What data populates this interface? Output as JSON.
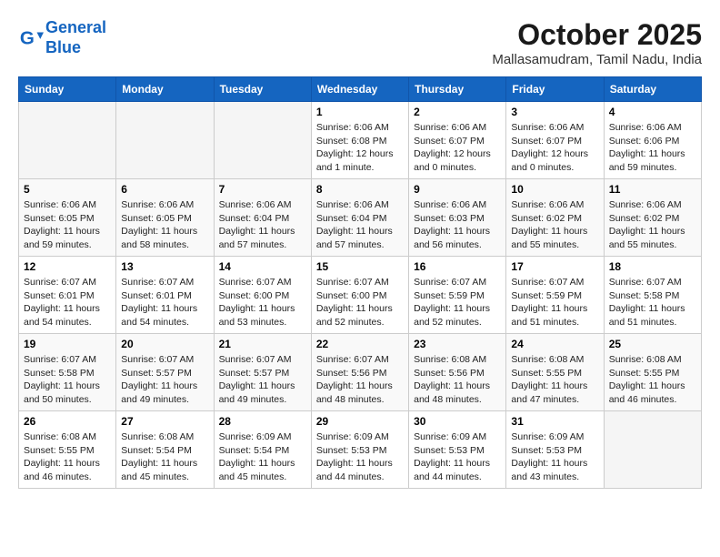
{
  "header": {
    "logo_line1": "General",
    "logo_line2": "Blue",
    "month": "October 2025",
    "location": "Mallasamudram, Tamil Nadu, India"
  },
  "weekdays": [
    "Sunday",
    "Monday",
    "Tuesday",
    "Wednesday",
    "Thursday",
    "Friday",
    "Saturday"
  ],
  "weeks": [
    [
      {
        "day": "",
        "info": ""
      },
      {
        "day": "",
        "info": ""
      },
      {
        "day": "",
        "info": ""
      },
      {
        "day": "1",
        "info": "Sunrise: 6:06 AM\nSunset: 6:08 PM\nDaylight: 12 hours\nand 1 minute."
      },
      {
        "day": "2",
        "info": "Sunrise: 6:06 AM\nSunset: 6:07 PM\nDaylight: 12 hours\nand 0 minutes."
      },
      {
        "day": "3",
        "info": "Sunrise: 6:06 AM\nSunset: 6:07 PM\nDaylight: 12 hours\nand 0 minutes."
      },
      {
        "day": "4",
        "info": "Sunrise: 6:06 AM\nSunset: 6:06 PM\nDaylight: 11 hours\nand 59 minutes."
      }
    ],
    [
      {
        "day": "5",
        "info": "Sunrise: 6:06 AM\nSunset: 6:05 PM\nDaylight: 11 hours\nand 59 minutes."
      },
      {
        "day": "6",
        "info": "Sunrise: 6:06 AM\nSunset: 6:05 PM\nDaylight: 11 hours\nand 58 minutes."
      },
      {
        "day": "7",
        "info": "Sunrise: 6:06 AM\nSunset: 6:04 PM\nDaylight: 11 hours\nand 57 minutes."
      },
      {
        "day": "8",
        "info": "Sunrise: 6:06 AM\nSunset: 6:04 PM\nDaylight: 11 hours\nand 57 minutes."
      },
      {
        "day": "9",
        "info": "Sunrise: 6:06 AM\nSunset: 6:03 PM\nDaylight: 11 hours\nand 56 minutes."
      },
      {
        "day": "10",
        "info": "Sunrise: 6:06 AM\nSunset: 6:02 PM\nDaylight: 11 hours\nand 55 minutes."
      },
      {
        "day": "11",
        "info": "Sunrise: 6:06 AM\nSunset: 6:02 PM\nDaylight: 11 hours\nand 55 minutes."
      }
    ],
    [
      {
        "day": "12",
        "info": "Sunrise: 6:07 AM\nSunset: 6:01 PM\nDaylight: 11 hours\nand 54 minutes."
      },
      {
        "day": "13",
        "info": "Sunrise: 6:07 AM\nSunset: 6:01 PM\nDaylight: 11 hours\nand 54 minutes."
      },
      {
        "day": "14",
        "info": "Sunrise: 6:07 AM\nSunset: 6:00 PM\nDaylight: 11 hours\nand 53 minutes."
      },
      {
        "day": "15",
        "info": "Sunrise: 6:07 AM\nSunset: 6:00 PM\nDaylight: 11 hours\nand 52 minutes."
      },
      {
        "day": "16",
        "info": "Sunrise: 6:07 AM\nSunset: 5:59 PM\nDaylight: 11 hours\nand 52 minutes."
      },
      {
        "day": "17",
        "info": "Sunrise: 6:07 AM\nSunset: 5:59 PM\nDaylight: 11 hours\nand 51 minutes."
      },
      {
        "day": "18",
        "info": "Sunrise: 6:07 AM\nSunset: 5:58 PM\nDaylight: 11 hours\nand 51 minutes."
      }
    ],
    [
      {
        "day": "19",
        "info": "Sunrise: 6:07 AM\nSunset: 5:58 PM\nDaylight: 11 hours\nand 50 minutes."
      },
      {
        "day": "20",
        "info": "Sunrise: 6:07 AM\nSunset: 5:57 PM\nDaylight: 11 hours\nand 49 minutes."
      },
      {
        "day": "21",
        "info": "Sunrise: 6:07 AM\nSunset: 5:57 PM\nDaylight: 11 hours\nand 49 minutes."
      },
      {
        "day": "22",
        "info": "Sunrise: 6:07 AM\nSunset: 5:56 PM\nDaylight: 11 hours\nand 48 minutes."
      },
      {
        "day": "23",
        "info": "Sunrise: 6:08 AM\nSunset: 5:56 PM\nDaylight: 11 hours\nand 48 minutes."
      },
      {
        "day": "24",
        "info": "Sunrise: 6:08 AM\nSunset: 5:55 PM\nDaylight: 11 hours\nand 47 minutes."
      },
      {
        "day": "25",
        "info": "Sunrise: 6:08 AM\nSunset: 5:55 PM\nDaylight: 11 hours\nand 46 minutes."
      }
    ],
    [
      {
        "day": "26",
        "info": "Sunrise: 6:08 AM\nSunset: 5:55 PM\nDaylight: 11 hours\nand 46 minutes."
      },
      {
        "day": "27",
        "info": "Sunrise: 6:08 AM\nSunset: 5:54 PM\nDaylight: 11 hours\nand 45 minutes."
      },
      {
        "day": "28",
        "info": "Sunrise: 6:09 AM\nSunset: 5:54 PM\nDaylight: 11 hours\nand 45 minutes."
      },
      {
        "day": "29",
        "info": "Sunrise: 6:09 AM\nSunset: 5:53 PM\nDaylight: 11 hours\nand 44 minutes."
      },
      {
        "day": "30",
        "info": "Sunrise: 6:09 AM\nSunset: 5:53 PM\nDaylight: 11 hours\nand 44 minutes."
      },
      {
        "day": "31",
        "info": "Sunrise: 6:09 AM\nSunset: 5:53 PM\nDaylight: 11 hours\nand 43 minutes."
      },
      {
        "day": "",
        "info": ""
      }
    ]
  ]
}
